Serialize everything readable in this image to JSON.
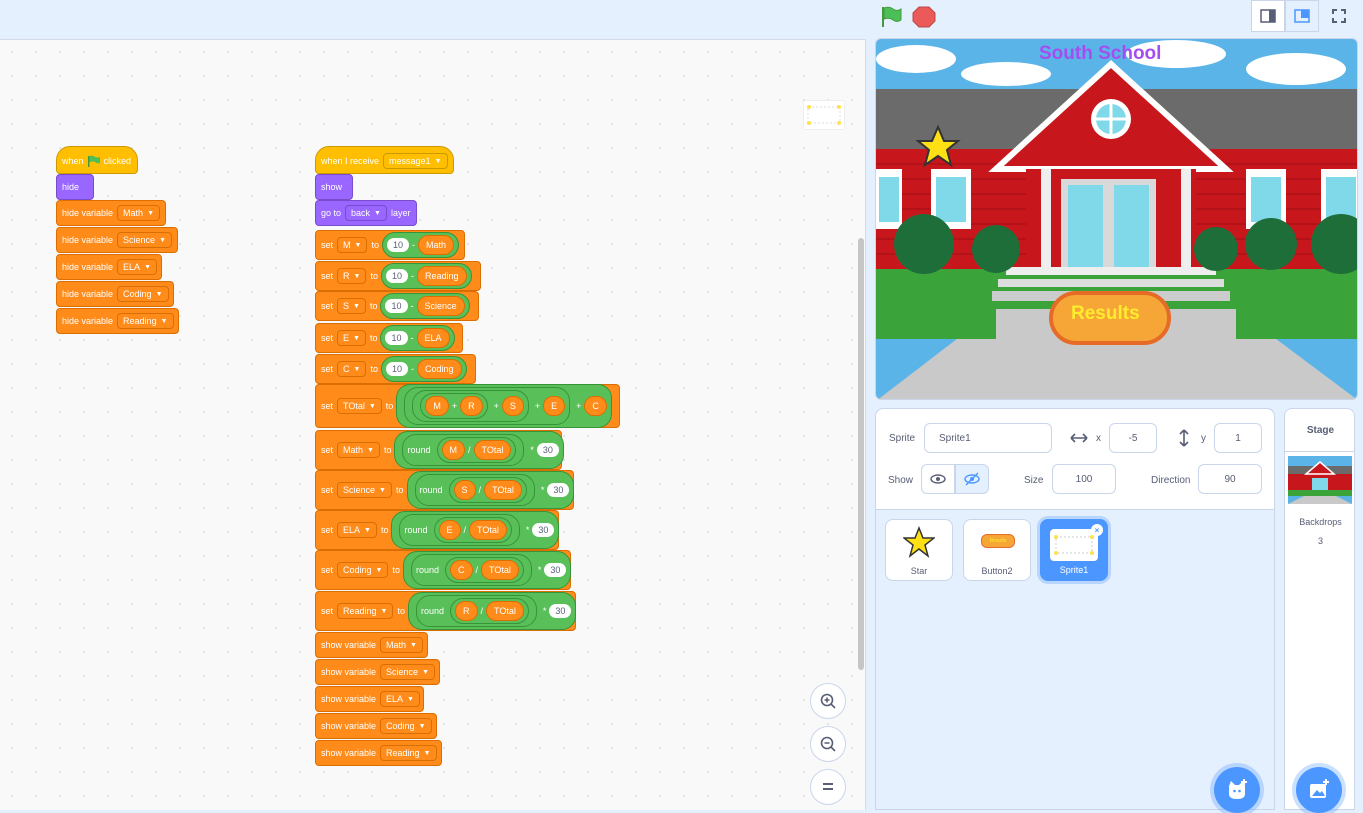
{
  "blocks_left": {
    "when": "when",
    "clicked": "clicked",
    "hide": "hide",
    "hide_variable": "hide variable",
    "vars": [
      "Math",
      "Science",
      "ELA",
      "Coding",
      "Reading"
    ]
  },
  "blocks_right": {
    "when_receive": "when I receive",
    "message": "message1",
    "show": "show",
    "go_to": "go to",
    "back": "back",
    "layer": "layer",
    "set": "set",
    "to": "to",
    "minus": "-",
    "ten": "10",
    "set_diff": [
      {
        "var": "M",
        "rep": "Math"
      },
      {
        "var": "R",
        "rep": "Reading"
      },
      {
        "var": "S",
        "rep": "Science"
      },
      {
        "var": "E",
        "rep": "ELA"
      },
      {
        "var": "C",
        "rep": "Coding"
      }
    ],
    "total": {
      "var": "TOtal",
      "items": [
        "M",
        "R",
        "S",
        "E",
        "C"
      ],
      "plus": "+"
    },
    "round": "round",
    "div": "/",
    "mul": "*",
    "thirty": "30",
    "set_round": [
      {
        "var": "Math",
        "rep": "M",
        "tot": "TOtal"
      },
      {
        "var": "Science",
        "rep": "S",
        "tot": "TOtal"
      },
      {
        "var": "ELA",
        "rep": "E",
        "tot": "TOtal"
      },
      {
        "var": "Coding",
        "rep": "C",
        "tot": "TOtal"
      },
      {
        "var": "Reading",
        "rep": "R",
        "tot": "TOtal"
      }
    ],
    "show_variable": "show variable",
    "show_vars": [
      "Math",
      "Science",
      "ELA",
      "Coding",
      "Reading"
    ]
  },
  "stage": {
    "title": "South School",
    "button": "Results"
  },
  "sprite_info": {
    "sprite_label": "Sprite",
    "sprite_name": "Sprite1",
    "x_label": "x",
    "x": "-5",
    "y_label": "y",
    "y": "1",
    "show_label": "Show",
    "size_label": "Size",
    "size": "100",
    "direction_label": "Direction",
    "direction": "90"
  },
  "sprites": [
    {
      "name": "Star"
    },
    {
      "name": "Button2",
      "thumb_text": "Results"
    },
    {
      "name": "Sprite1"
    }
  ],
  "stage_panel": {
    "title": "Stage",
    "backdrops_label": "Backdrops",
    "backdrops_count": "3"
  },
  "colors": {
    "accent": "#4c97ff",
    "events": "#ffbf00",
    "looks": "#9966ff",
    "variables": "#ff8c1a",
    "operators": "#59c059"
  }
}
